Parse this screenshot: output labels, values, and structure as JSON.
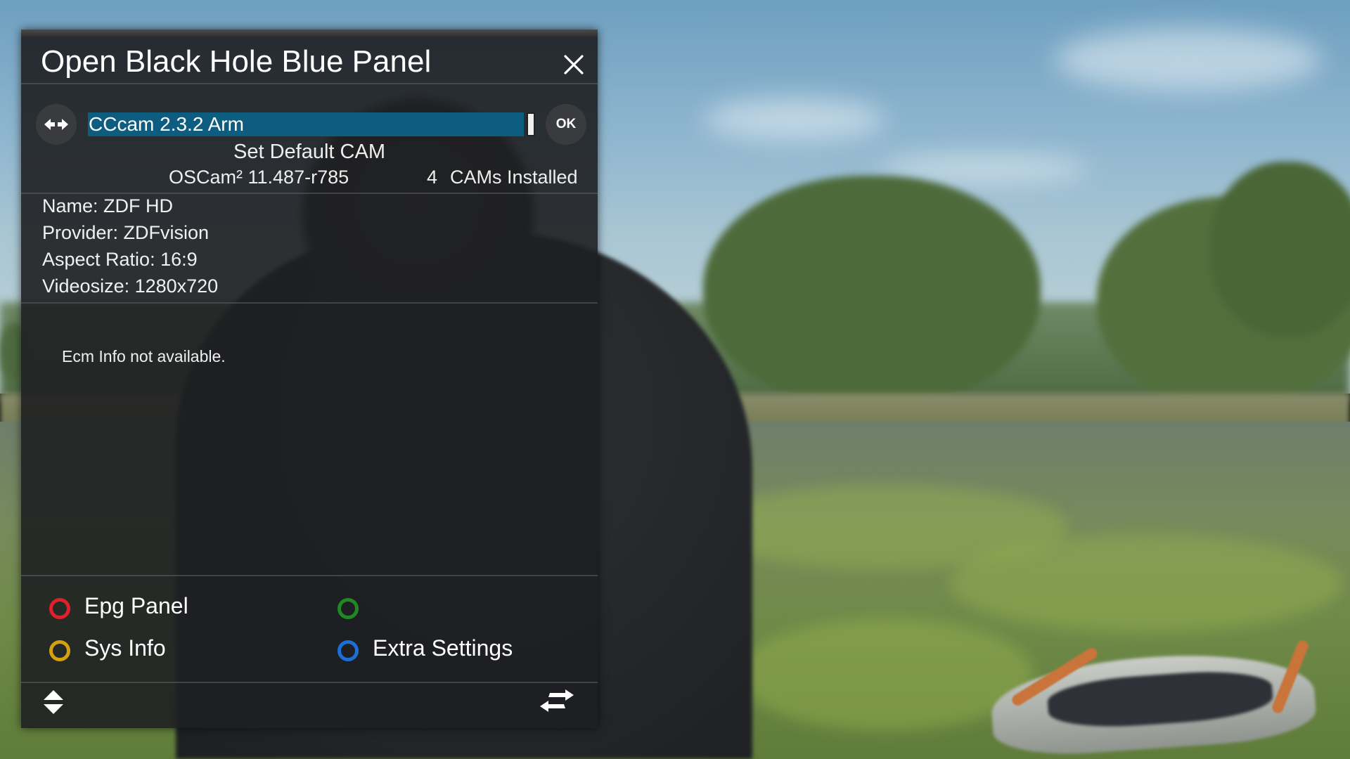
{
  "panel": {
    "title": "Open Black Hole Blue Panel",
    "selected_cam": "CCcam 2.3.2 Arm",
    "ok_label": "OK",
    "set_default_label": "Set Default CAM",
    "current_cam": "OSCam² 11.487-r785",
    "cams_installed_count": "4",
    "cams_installed_label": "CAMs Installed"
  },
  "channel_info": {
    "name": "Name: ZDF HD",
    "provider": "Provider: ZDFvision",
    "aspect_ratio": "Aspect Ratio: 16:9",
    "videosize": "Videosize: 1280x720"
  },
  "ecm_info": "Ecm Info not available.",
  "color_keys": {
    "red": {
      "label": "Epg Panel",
      "color": "#e0202a"
    },
    "green": {
      "label": "",
      "color": "#1e8a22"
    },
    "yellow": {
      "label": "Sys Info",
      "color": "#d4a20e"
    },
    "blue": {
      "label": "Extra Settings",
      "color": "#1a6fd8"
    }
  },
  "icons": {
    "close": "close-icon",
    "left_right": "left-right-arrows-icon",
    "up_down": "up-down-arrows-icon",
    "swap": "swap-arrows-icon"
  },
  "accent_colors": {
    "selection_bar": "#0d5d80",
    "panel_background": "#1e1f21"
  }
}
